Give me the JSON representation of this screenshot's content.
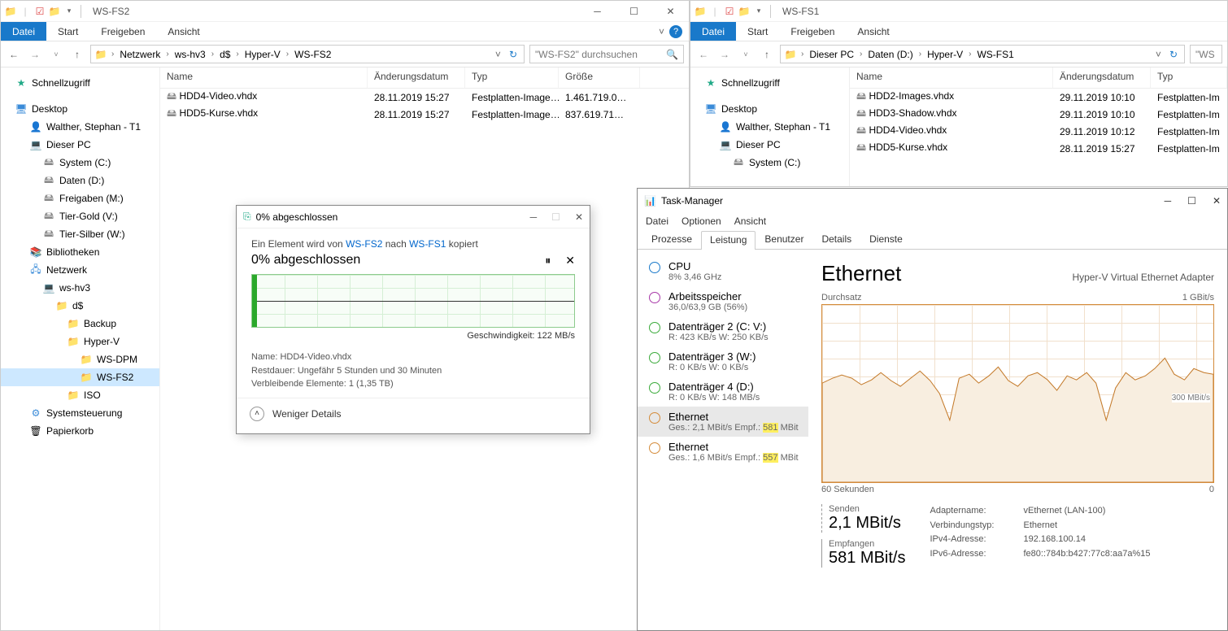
{
  "explorer1": {
    "title": "WS-FS2",
    "ribbon": {
      "file": "Datei",
      "tabs": [
        "Start",
        "Freigeben",
        "Ansicht"
      ]
    },
    "breadcrumbs": [
      "Netzwerk",
      "ws-hv3",
      "d$",
      "Hyper-V",
      "WS-FS2"
    ],
    "search_placeholder": "\"WS-FS2\" durchsuchen",
    "columns": {
      "name": "Name",
      "date": "Änderungsdatum",
      "type": "Typ",
      "size": "Größe"
    },
    "files": [
      {
        "name": "HDD4-Video.vhdx",
        "date": "28.11.2019 15:27",
        "type": "Festplatten-Image…",
        "size": "1.461.719.0…"
      },
      {
        "name": "HDD5-Kurse.vhdx",
        "date": "28.11.2019 15:27",
        "type": "Festplatten-Image…",
        "size": "837.619.71…"
      }
    ],
    "nav": {
      "quick": "Schnellzugriff",
      "desktop": "Desktop",
      "user": "Walther, Stephan - T1",
      "thispc": "Dieser PC",
      "drives": [
        "System (C:)",
        "Daten (D:)",
        "Freigaben (M:)",
        "Tier-Gold (V:)",
        "Tier-Silber (W:)"
      ],
      "libs": "Bibliotheken",
      "network": "Netzwerk",
      "host": "ws-hv3",
      "share": "d$",
      "folders": [
        "Backup",
        "Hyper-V"
      ],
      "subfolders": [
        "WS-DPM",
        "WS-FS2"
      ],
      "iso": "ISO",
      "control": "Systemsteuerung",
      "trash": "Papierkorb"
    }
  },
  "explorer2": {
    "title": "WS-FS1",
    "ribbon": {
      "file": "Datei",
      "tabs": [
        "Start",
        "Freigeben",
        "Ansicht"
      ]
    },
    "breadcrumbs": [
      "Dieser PC",
      "Daten (D:)",
      "Hyper-V",
      "WS-FS1"
    ],
    "search_placeholder": "\"WS",
    "columns": {
      "name": "Name",
      "date": "Änderungsdatum",
      "type": "Typ"
    },
    "files": [
      {
        "name": "HDD2-Images.vhdx",
        "date": "29.11.2019 10:10",
        "type": "Festplatten-Im"
      },
      {
        "name": "HDD3-Shadow.vhdx",
        "date": "29.11.2019 10:10",
        "type": "Festplatten-Im"
      },
      {
        "name": "HDD4-Video.vhdx",
        "date": "29.11.2019 10:12",
        "type": "Festplatten-Im"
      },
      {
        "name": "HDD5-Kurse.vhdx",
        "date": "28.11.2019 15:27",
        "type": "Festplatten-Im"
      }
    ],
    "nav": {
      "quick": "Schnellzugriff",
      "desktop": "Desktop",
      "user": "Walther, Stephan - T1",
      "thispc": "Dieser PC",
      "drives": [
        "System (C:)"
      ]
    }
  },
  "copydlg": {
    "title": "0% abgeschlossen",
    "line_pre": "Ein Element wird von ",
    "src": "WS-FS2",
    "line_mid": " nach ",
    "dst": "WS-FS1",
    "line_post": " kopiert",
    "pct": "0% abgeschlossen",
    "speed": "Geschwindigkeit: 122 MB/s",
    "name_label": "Name:  HDD4-Video.vhdx",
    "remaining": "Restdauer:  Ungefähr 5 Stunden und 30 Minuten",
    "items": "Verbleibende Elemente:  1 (1,35 TB)",
    "less": "Weniger Details"
  },
  "taskmgr": {
    "title": "Task-Manager",
    "menu": [
      "Datei",
      "Optionen",
      "Ansicht"
    ],
    "tabs": [
      "Prozesse",
      "Leistung",
      "Benutzer",
      "Details",
      "Dienste"
    ],
    "active_tab": 1,
    "side": [
      {
        "color": "blue",
        "label": "CPU",
        "sub": "8%  3,46 GHz"
      },
      {
        "color": "purple",
        "label": "Arbeitsspeicher",
        "sub": "36,0/63,9 GB (56%)"
      },
      {
        "color": "green",
        "label": "Datenträger 2 (C: V:)",
        "sub": "R: 423 KB/s  W: 250 KB/s"
      },
      {
        "color": "green",
        "label": "Datenträger 3 (W:)",
        "sub": "R: 0 KB/s  W: 0 KB/s"
      },
      {
        "color": "green",
        "label": "Datenträger 4 (D:)",
        "sub": "R: 0 KB/s  W: 148 MB/s"
      },
      {
        "color": "orange",
        "label": "Ethernet",
        "sub_pre": "Ges.: 2,1 MBit/s  Empf.: ",
        "hl": "581",
        "sub_post": " MBit",
        "selected": true
      },
      {
        "color": "orange",
        "label": "Ethernet",
        "sub_pre": "Ges.: 1,6 MBit/s  Empf.: ",
        "hl": "557",
        "sub_post": " MBit"
      }
    ],
    "main": {
      "title": "Ethernet",
      "adapter": "Hyper-V Virtual Ethernet Adapter",
      "throughput": "Durchsatz",
      "max": "1 GBit/s",
      "midlabel": "300 MBit/s",
      "x_left": "60 Sekunden",
      "x_right": "0",
      "send_label": "Senden",
      "send_val": "2,1 MBit/s",
      "recv_label": "Empfangen",
      "recv_val": "581 MBit/s",
      "details": {
        "adaptername_k": "Adaptername:",
        "adaptername_v": "vEthernet (LAN-100)",
        "conntype_k": "Verbindungstyp:",
        "conntype_v": "Ethernet",
        "ipv4_k": "IPv4-Adresse:",
        "ipv4_v": "192.168.100.14",
        "ipv6_k": "IPv6-Adresse:",
        "ipv6_v": "fe80::784b:b427:77c8:aa7a%15"
      }
    }
  },
  "chart_data": [
    {
      "type": "line",
      "title": "Copy speed",
      "ylabel": "MB/s",
      "ylim": [
        0,
        244
      ],
      "current_value": 122,
      "annotation": "Geschwindigkeit: 122 MB/s"
    },
    {
      "type": "line",
      "title": "Ethernet Durchsatz",
      "xlabel": "Sekunden",
      "ylabel": "MBit/s",
      "x_range": [
        60,
        0
      ],
      "ylim": [
        0,
        1000
      ],
      "gridline_at": 300,
      "series": [
        {
          "name": "Empfangen",
          "approx_values_mbits": [
            560,
            590,
            610,
            590,
            550,
            580,
            620,
            570,
            540,
            590,
            630,
            570,
            500,
            350,
            590,
            610,
            560,
            600,
            650,
            570,
            540,
            600,
            620,
            580,
            520,
            600,
            580,
            620,
            560,
            350,
            530,
            620,
            580,
            600,
            640,
            700,
            610,
            580,
            640,
            620
          ],
          "current": 581
        },
        {
          "name": "Senden",
          "approx_values_mbits": [
            2,
            2,
            2,
            2,
            2,
            2,
            2,
            2,
            2,
            2,
            2,
            2,
            2,
            2,
            2,
            2,
            2,
            2,
            2,
            2,
            2,
            2,
            2,
            2,
            2,
            2,
            2,
            2,
            2,
            2,
            2,
            2,
            2,
            2,
            2,
            2,
            2,
            2,
            2,
            2
          ],
          "current": 2.1
        }
      ]
    }
  ]
}
